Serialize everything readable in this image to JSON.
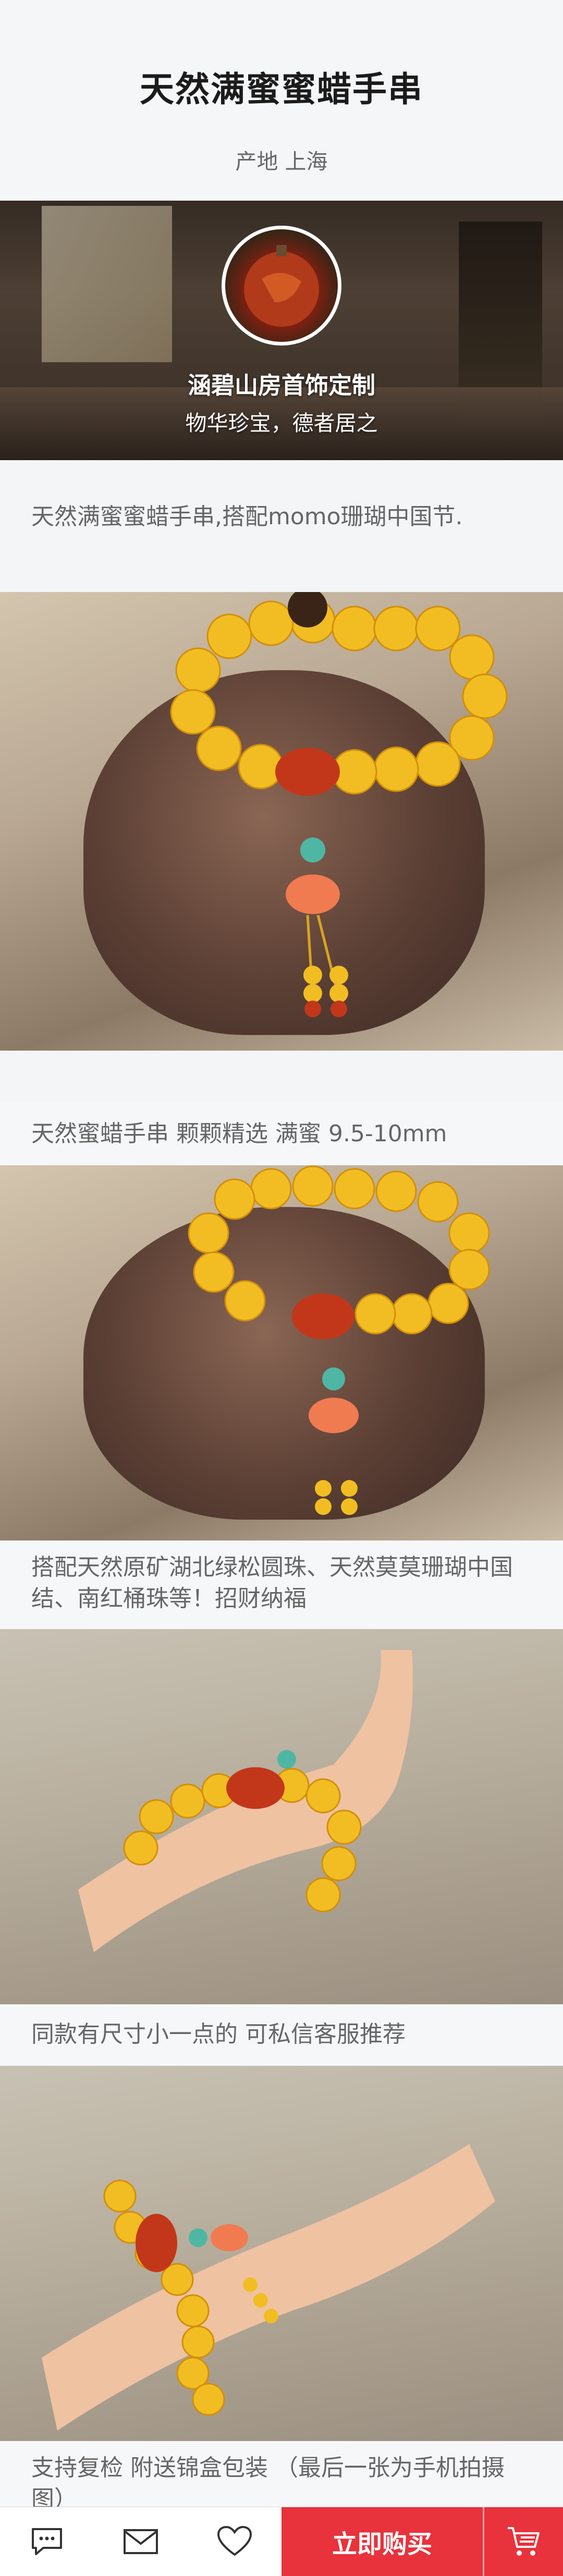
{
  "product": {
    "title": "天然满蜜蜜蜡手串",
    "origin": "产地 上海"
  },
  "shop": {
    "name": "涵碧山房首饰定制",
    "slogan": "物华珍宝，德者居之"
  },
  "description": "天然满蜜蜜蜡手串,搭配momo珊瑚中国节.",
  "captions": [
    "天然蜜蜡手串 颗颗精选 满蜜 9.5-10mm",
    "搭配天然原矿湖北绿松圆珠、天然莫莫珊瑚中国结、南红桶珠等！招财纳福",
    "同款有尺寸小一点的 可私信客服推荐",
    "支持复检 附送锦盒包装 （最后一张为手机拍摄图）"
  ],
  "bottom_bar": {
    "buy_label": "立即购买",
    "icons": [
      "chat-icon",
      "mail-icon",
      "heart-icon",
      "cart-icon"
    ]
  },
  "colors": {
    "accent": "#e8323c",
    "amber": "#f4c025"
  }
}
